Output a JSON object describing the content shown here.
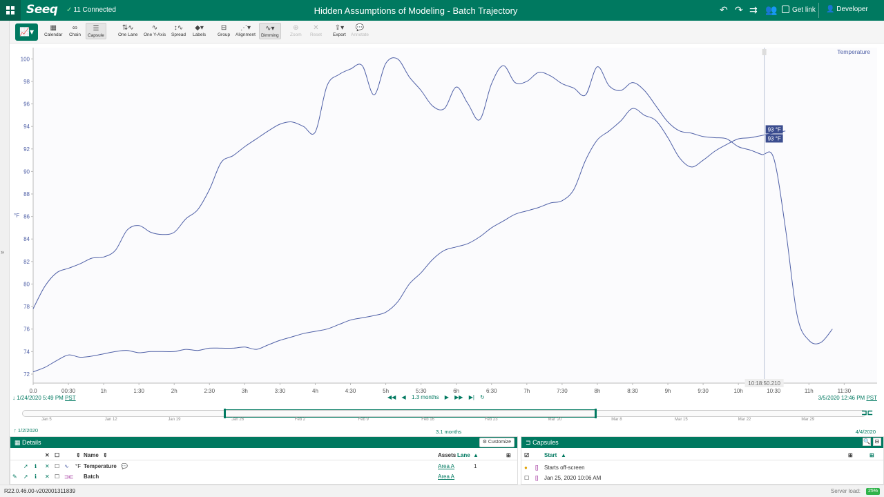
{
  "header": {
    "logo": "Seeq",
    "connection_status": "11 Connected",
    "title": "Hidden Assumptions of Modeling - Batch Trajectory",
    "get_link_label": "Get link",
    "user_label": "Developer"
  },
  "toolbar": {
    "buttons": [
      {
        "label": "Calendar",
        "icon": "calendar-icon"
      },
      {
        "label": "Chain",
        "icon": "chain-icon"
      },
      {
        "label": "Capsule",
        "icon": "capsule-icon"
      },
      {
        "label": "One Lane",
        "icon": "one-lane-icon"
      },
      {
        "label": "One Y-Axis",
        "icon": "one-y-axis-icon"
      },
      {
        "label": "Spread",
        "icon": "spread-icon"
      },
      {
        "label": "Labels",
        "icon": "labels-icon"
      },
      {
        "label": "Group",
        "icon": "group-icon"
      },
      {
        "label": "Alignment",
        "icon": "alignment-icon"
      },
      {
        "label": "Dimming",
        "icon": "dimming-icon"
      },
      {
        "label": "Zoom",
        "icon": "zoom-icon"
      },
      {
        "label": "Reset",
        "icon": "reset-icon"
      },
      {
        "label": "Export",
        "icon": "export-icon"
      },
      {
        "label": "Annotate",
        "icon": "annotate-icon"
      }
    ]
  },
  "chart_data": {
    "type": "line",
    "title": "",
    "xlabel": "",
    "ylabel": "°F",
    "legend": "Temperature",
    "ylim": [
      71.2,
      101
    ],
    "xlim": [
      0,
      71.8
    ],
    "y_ticks": [
      "72",
      "74",
      "76",
      "78",
      "80",
      "82",
      "84",
      "86",
      "88",
      "90",
      "92",
      "94",
      "96",
      "98",
      "100"
    ],
    "x_ticks": [
      "0.0",
      "00:30",
      "1h",
      "1:30",
      "2h",
      "2:30",
      "3h",
      "3:30",
      "4h",
      "4:30",
      "5h",
      "5:30",
      "6h",
      "6:30",
      "7h",
      "7:30",
      "8h",
      "8:30",
      "9h",
      "9:30",
      "10h",
      "10:30",
      "11h",
      "11:30"
    ],
    "cursor": {
      "label": "10:18:50.210",
      "x": 62.2,
      "values": [
        "93 °F",
        "93 °F"
      ]
    },
    "series": [
      {
        "name": "Temperature",
        "color": "#4e5fa6",
        "x": [
          0,
          1,
          2,
          3,
          4,
          5,
          6,
          7,
          8,
          9,
          10,
          11,
          12,
          13,
          14,
          15,
          16,
          17,
          18,
          19,
          20,
          21,
          22,
          23,
          24,
          25,
          26,
          27,
          28,
          29,
          30,
          31,
          32,
          33,
          34,
          35,
          36,
          37,
          38,
          39,
          40,
          41,
          42,
          43,
          44,
          45,
          46,
          47,
          48,
          49,
          50,
          51,
          52,
          53,
          54,
          55,
          56,
          57,
          58,
          59,
          60,
          61,
          62,
          63,
          64,
          65,
          66,
          67,
          68
        ],
        "values": [
          77.8,
          79.8,
          81.0,
          81.4,
          81.8,
          82.3,
          82.4,
          83.0,
          84.8,
          85.2,
          84.6,
          84.4,
          84.6,
          85.8,
          86.6,
          88.4,
          90.8,
          91.4,
          92.2,
          92.9,
          93.6,
          94.2,
          94.4,
          94.0,
          93.5,
          97.6,
          98.6,
          99.1,
          99.4,
          96.8,
          99.6,
          100.0,
          98.4,
          97.2,
          95.8,
          95.6,
          97.5,
          96.0,
          94.6,
          97.8,
          99.4,
          97.9,
          98.0,
          98.8,
          98.5,
          97.8,
          97.4,
          96.8,
          99.3,
          97.6,
          97.2,
          97.9,
          97.2,
          95.8,
          94.4,
          93.6,
          93.4,
          93.1,
          93.0,
          92.9,
          92.2,
          91.9,
          91.5,
          91.2,
          85.0,
          77.2,
          75.0,
          74.8,
          76.0
        ]
      },
      {
        "name": "",
        "color": "#4e5fa6",
        "x": [
          0,
          1,
          2,
          3,
          4,
          5,
          6,
          7,
          8,
          9,
          10,
          11,
          12,
          13,
          14,
          15,
          16,
          17,
          18,
          19,
          20,
          21,
          22,
          23,
          24,
          25,
          26,
          27,
          28,
          29,
          30,
          31,
          32,
          33,
          34,
          35,
          36,
          37,
          38,
          39,
          40,
          41,
          42,
          43,
          44,
          45,
          46,
          47,
          48,
          49,
          50,
          51,
          52,
          53,
          54,
          55,
          56,
          57,
          58,
          59,
          60,
          61,
          62,
          63,
          64
        ],
        "values": [
          72.2,
          72.6,
          73.2,
          73.7,
          73.5,
          73.6,
          73.8,
          74.0,
          74.1,
          73.9,
          74.0,
          74.0,
          74.0,
          74.2,
          74.1,
          74.3,
          74.3,
          74.3,
          74.4,
          74.2,
          74.6,
          75.0,
          75.3,
          75.6,
          75.8,
          76.0,
          76.4,
          76.8,
          77.0,
          77.2,
          77.5,
          78.4,
          80.0,
          81.0,
          82.2,
          83.0,
          83.3,
          83.6,
          84.2,
          85.0,
          85.6,
          86.2,
          86.5,
          86.8,
          87.2,
          87.4,
          88.4,
          91.0,
          92.8,
          93.6,
          94.5,
          95.6,
          95.0,
          94.5,
          93.0,
          91.2,
          90.4,
          91.0,
          91.8,
          92.4,
          92.9,
          93.0,
          93.2,
          93.4,
          93.6
        ]
      }
    ]
  },
  "time_range": {
    "start": "1/24/2020 5:49 PM",
    "start_tz": "PST",
    "end": "3/5/2020 12:46 PM",
    "end_tz": "PST",
    "duration": "1.3 months"
  },
  "overview": {
    "ticks": [
      "Jan 5",
      "Jan 12",
      "Jan 19",
      "Jan 26",
      "Feb 2",
      "Feb 9",
      "Feb 16",
      "Feb 23",
      "Mar '20",
      "Mar 8",
      "Mar 15",
      "Mar 22",
      "Mar 29"
    ],
    "start": "1/2/2020",
    "end": "4/4/2020",
    "duration": "3.1 months"
  },
  "details": {
    "title": "Details",
    "customize_label": "Customize",
    "columns": {
      "name": "Name",
      "assets": "Assets",
      "lane": "Lane"
    },
    "rows": [
      {
        "unit": "°F",
        "name": "Temperature",
        "asset": "Area A",
        "lane": "1"
      },
      {
        "unit": "",
        "name": "Batch",
        "asset": "Area A",
        "lane": ""
      }
    ]
  },
  "capsules": {
    "title": "Capsules",
    "column_start": "Start",
    "rows": [
      {
        "label": "Starts off-screen"
      },
      {
        "label": "Jan 25, 2020 10:06 AM"
      }
    ]
  },
  "footer": {
    "version": "R22.0.46.00-v202001311839",
    "server_load_label": "Server load:",
    "server_load_value": "25%"
  }
}
